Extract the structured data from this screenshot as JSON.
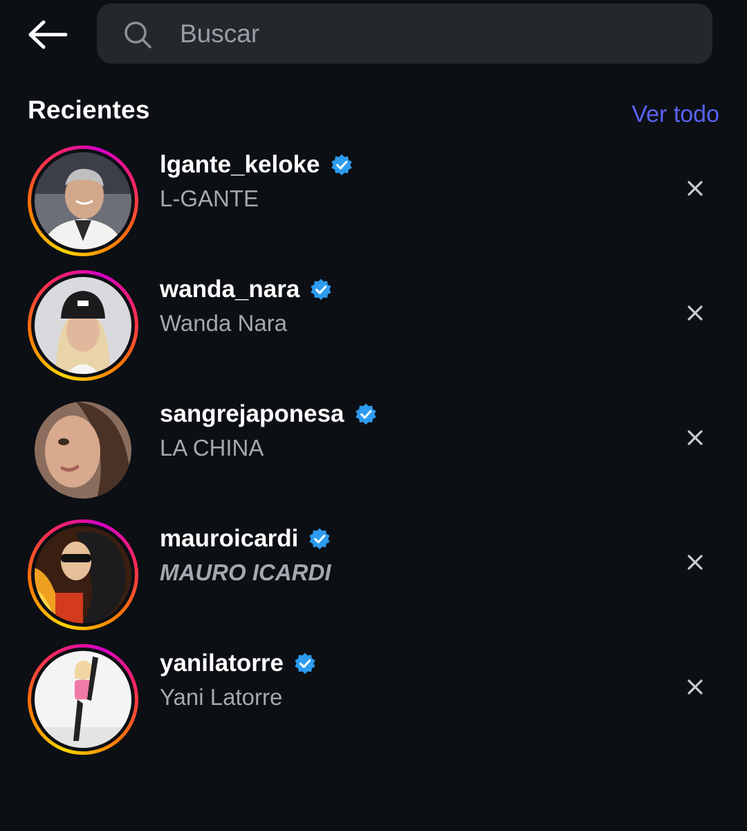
{
  "search": {
    "placeholder": "Buscar"
  },
  "recent": {
    "title": "Recientes",
    "see_all": "Ver todo",
    "items": [
      {
        "username": "lgante_keloke",
        "full_name": "L-GANTE",
        "verified": true,
        "story_ring": true
      },
      {
        "username": "wanda_nara",
        "full_name": "Wanda Nara",
        "verified": true,
        "story_ring": true
      },
      {
        "username": "sangrejaponesa",
        "full_name": "LA CHINA",
        "verified": true,
        "story_ring": false
      },
      {
        "username": "mauroicardi",
        "full_name": "MAURO ICARDI",
        "verified": true,
        "story_ring": true
      },
      {
        "username": "yanilatorre",
        "full_name": "Yani Latorre",
        "verified": true,
        "story_ring": true
      }
    ]
  },
  "colors": {
    "background": "#0c0f14",
    "link": "#5a63f3",
    "verified": "#2d9bf0",
    "secondary_text": "#a4a8af"
  },
  "icons": {
    "back": "arrow-left-icon",
    "search": "search-icon",
    "verified": "verified-badge-icon",
    "remove": "close-icon"
  }
}
